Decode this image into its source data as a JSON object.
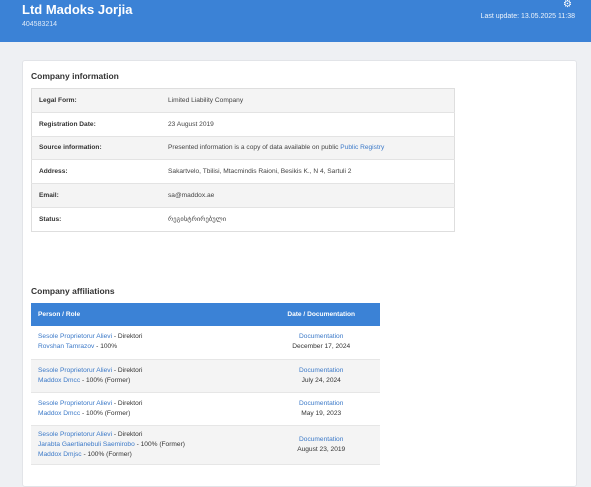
{
  "header": {
    "company_name": "Ltd Madoks Jorjia",
    "company_id": "404583214",
    "last_update": "Last update: 13.05.2025 11:38"
  },
  "company_info": {
    "title": "Company information",
    "rows": [
      {
        "label": "Legal Form:",
        "value": "Limited Liability Company"
      },
      {
        "label": "Registration Date:",
        "value": "23 August 2019"
      },
      {
        "label": "Source information:",
        "value": "Presented information is a copy of data available on public",
        "link": "Public Registry"
      },
      {
        "label": "Address:",
        "value": "Sakartvelo, Tbilisi, Mtacmindis Raioni, Besikis K., N 4, Sartuli 2"
      },
      {
        "label": "Email:",
        "value": "sa@maddox.ae"
      },
      {
        "label": "Status:",
        "value": "რეგისტრირებული"
      }
    ]
  },
  "affiliations": {
    "title": "Company affiliations",
    "headers": {
      "person": "Person / Role",
      "date": "Date / Documentation"
    },
    "rows": [
      {
        "line1": {
          "name": "Sesole Proprietorur Alievi",
          "role": " - Direktori"
        },
        "line2": {
          "name": "Rovshan Tamrazov",
          "role": " - 100%"
        },
        "doc": "Documentation",
        "date": "December 17, 2024"
      },
      {
        "line1": {
          "name": "Sesole Proprietorur Alievi",
          "role": " - Direktori"
        },
        "line2": {
          "name": "Maddox Dmcc",
          "role": " - 100% (Former)"
        },
        "doc": "Documentation",
        "date": "July 24, 2024"
      },
      {
        "line1": {
          "name": "Sesole Proprietorur Alievi",
          "role": " - Direktori"
        },
        "line2": {
          "name": "Maddox Dmcc",
          "role": " - 100% (Former)"
        },
        "doc": "Documentation",
        "date": "May 19, 2023"
      },
      {
        "line1": {
          "name": "Sesole Proprietorur Alievi",
          "role": " - Direktori"
        },
        "line2": {
          "name": "Jarabta Gaertianebuli Saemirobo",
          "role": " - 100% (Former)"
        },
        "line3": {
          "name": "Maddox Dmjsc",
          "role": " - 100% (Former)"
        },
        "doc": "Documentation",
        "date": "August 23, 2019"
      }
    ]
  },
  "icons": {
    "settings": "gear-icon"
  },
  "colors": {
    "header_bg": "#3b82d6",
    "link": "#3b79c8",
    "page_bg": "#eef0f3"
  }
}
